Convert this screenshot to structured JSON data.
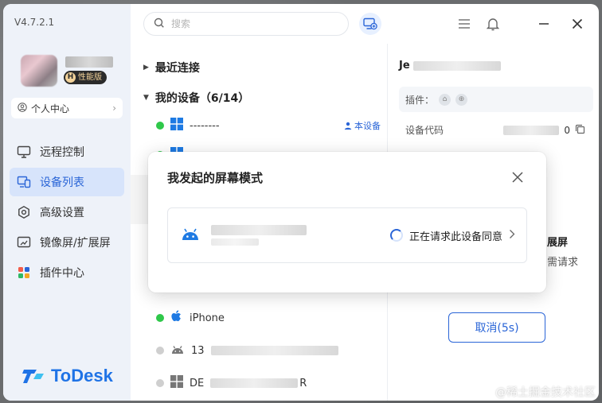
{
  "app": {
    "version": "V4.7.2.1",
    "brand": "ToDesk",
    "accent": "#2a65d7"
  },
  "profile": {
    "badge_letter": "H",
    "badge_label": "性能版",
    "center_label": "个人中心"
  },
  "nav": [
    {
      "label": "远程控制",
      "icon": "monitor-icon",
      "active": false
    },
    {
      "label": "设备列表",
      "icon": "devices-icon",
      "active": true
    },
    {
      "label": "高级设置",
      "icon": "settings-icon",
      "active": false
    },
    {
      "label": "镜像屏/扩展屏",
      "icon": "mirror-screen-icon",
      "active": false
    },
    {
      "label": "插件中心",
      "icon": "plugins-icon",
      "active": false
    }
  ],
  "search": {
    "placeholder": "搜索"
  },
  "list": {
    "recent_label": "最近连接",
    "my_devices_label": "我的设备（6/14）",
    "rows": [
      {
        "name": "--------",
        "os": "windows",
        "online": true,
        "tag": "本设备"
      },
      {
        "name": "iPhone",
        "os": "apple",
        "online": true
      },
      {
        "name": "13",
        "os": "android",
        "online": false
      },
      {
        "name": "DE",
        "os": "windows",
        "online": false,
        "suffix": "R"
      }
    ]
  },
  "detail": {
    "name_prefix": "Je",
    "plugins_label": "插件：",
    "code_label": "设备代码",
    "code_suffix": "0",
    "partial_title": "展屏",
    "partial_sub": "需请求",
    "cancel_label": "取消(5s)"
  },
  "modal": {
    "title": "我发起的屏幕模式",
    "status": "正在请求此设备同意"
  },
  "watermark": "@稀土掘金技术社区"
}
